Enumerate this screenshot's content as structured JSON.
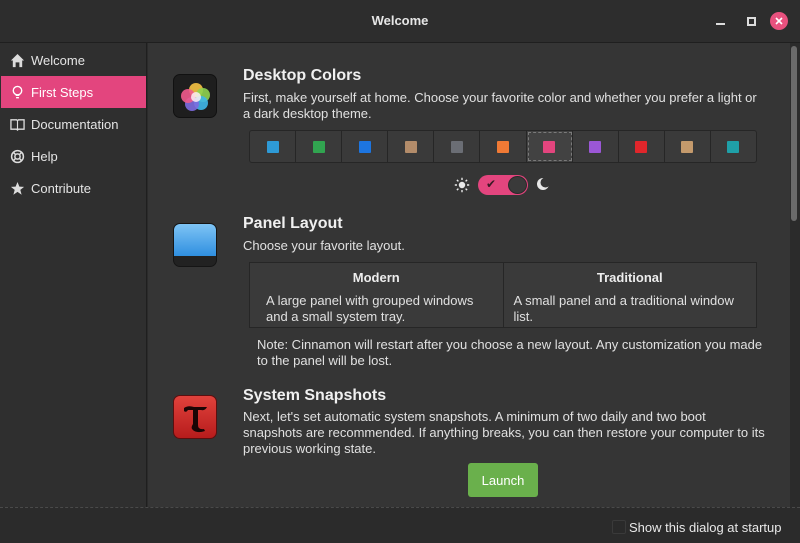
{
  "window": {
    "title": "Welcome"
  },
  "sidebar": {
    "items": [
      {
        "label": "Welcome",
        "icon": "home-icon"
      },
      {
        "label": "First Steps",
        "icon": "lightbulb-icon"
      },
      {
        "label": "Documentation",
        "icon": "book-icon"
      },
      {
        "label": "Help",
        "icon": "lifebuoy-icon"
      },
      {
        "label": "Contribute",
        "icon": "star-icon"
      }
    ],
    "active_index": 1
  },
  "desktop_colors": {
    "title": "Desktop Colors",
    "description": "First, make yourself at home. Choose your favorite color and whether you prefer a light or a dark desktop theme.",
    "swatches": [
      "#2e9ad6",
      "#31a450",
      "#1d75e0",
      "#b38c6a",
      "#6b6e75",
      "#f07a35",
      "#e3457e",
      "#9b57d6",
      "#e0262b",
      "#c49a6c",
      "#1fa0a8"
    ],
    "selected_index": 6,
    "theme_toggle": {
      "dark": true,
      "check_glyph": "✔"
    }
  },
  "panel_layout": {
    "title": "Panel Layout",
    "description": "Choose your favorite layout.",
    "options": [
      {
        "name": "Modern",
        "desc": "A large panel with grouped windows and a small system tray."
      },
      {
        "name": "Traditional",
        "desc": "A small panel and a traditional window list."
      }
    ],
    "note": "Note: Cinnamon will restart after you choose a new layout. Any customization you made to the panel will be lost."
  },
  "system_snapshots": {
    "title": "System Snapshots",
    "description": "Next, let's set automatic system snapshots. A minimum of two daily and two boot snapshots are recommended. If anything breaks, you can then restore your computer to its previous working state.",
    "button": "Launch"
  },
  "footer": {
    "startup_label": "Show this dialog at startup",
    "startup_checked": false
  },
  "colors": {
    "accent": "#e3457e",
    "launch": "#6ab04c"
  }
}
